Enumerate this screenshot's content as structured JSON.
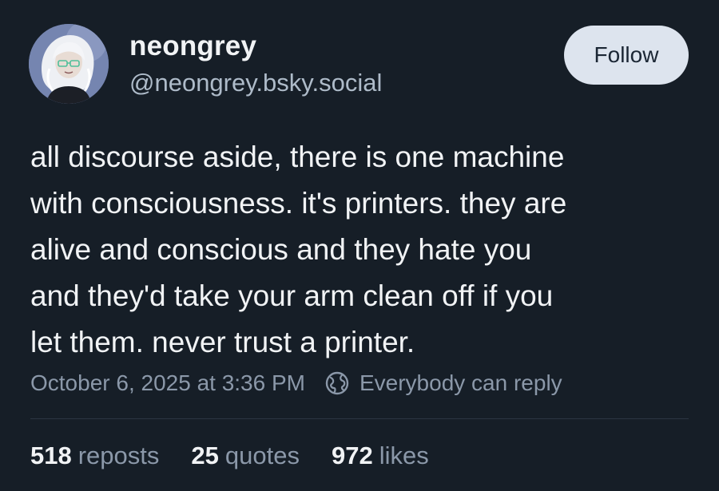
{
  "author": {
    "display_name": "neongrey",
    "handle": "@neongrey.bsky.social"
  },
  "follow_button": {
    "label": "Follow"
  },
  "post": {
    "text": "all discourse aside, there is one machine\nwith consciousness. it's printers. they are\nalive and conscious and they hate you\nand they'd take your arm clean off if you\nlet them. never trust a printer."
  },
  "meta": {
    "timestamp": "October 6, 2025 at 3:36 PM",
    "reply_setting": "Everybody can reply",
    "reply_icon": "globe-icon"
  },
  "stats": {
    "reposts": {
      "count": "518",
      "label": "reposts"
    },
    "quotes": {
      "count": "25",
      "label": "quotes"
    },
    "likes": {
      "count": "972",
      "label": "likes"
    }
  },
  "colors": {
    "background": "#161e27",
    "text": "#f1f3f5",
    "muted": "#8b98a9",
    "follow_bg": "#dde4ee"
  }
}
